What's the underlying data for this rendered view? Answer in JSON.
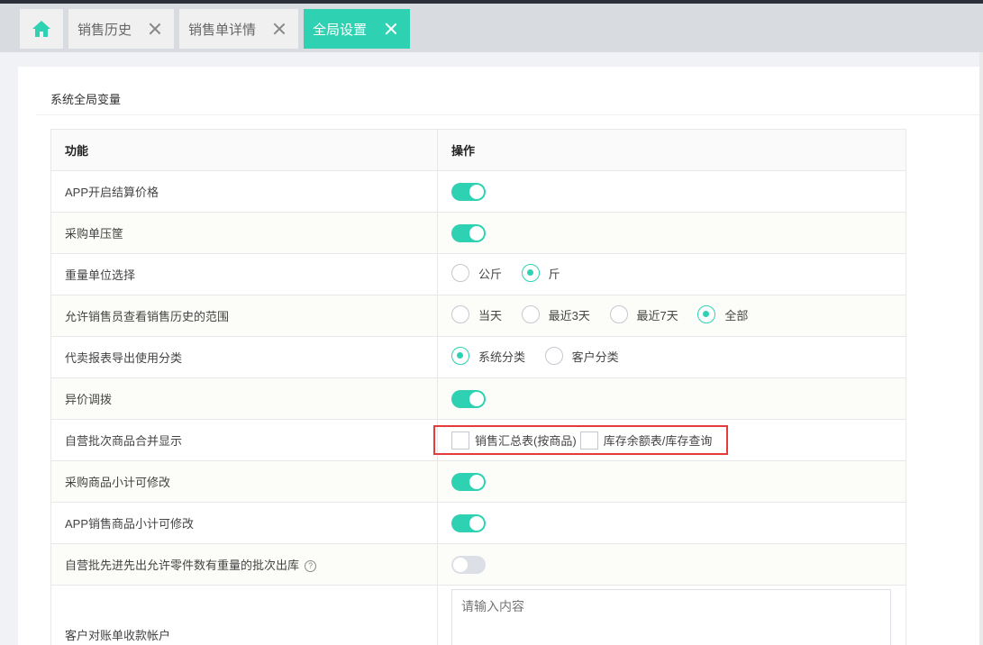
{
  "tabs": [
    {
      "label": "销售历史"
    },
    {
      "label": "销售单详情"
    },
    {
      "label": "全局设置",
      "active": true
    }
  ],
  "section_title": "系统全局变量",
  "table": {
    "headers": {
      "feature": "功能",
      "action": "操作"
    },
    "rows": [
      {
        "label": "APP开启结算价格",
        "switch": true
      },
      {
        "label": "采购单压筐",
        "switch": true
      },
      {
        "label": "重量单位选择",
        "options": [
          "公斤",
          "斤"
        ],
        "selected": 1
      },
      {
        "label": "允许销售员查看销售历史的范围",
        "options": [
          "当天",
          "最近3天",
          "最近7天",
          "全部"
        ],
        "selected": 3
      },
      {
        "label": "代卖报表导出使用分类",
        "options": [
          "系统分类",
          "客户分类"
        ],
        "selected": 0
      },
      {
        "label": "异价调拨",
        "switch": true
      },
      {
        "label": "自营批次商品合并显示",
        "checkboxes": [
          "销售汇总表(按商品)",
          "库存余额表/库存查询"
        ]
      },
      {
        "label": "采购商品小计可修改",
        "switch": true
      },
      {
        "label": "APP销售商品小计可修改",
        "switch": true
      },
      {
        "label": "自营批先进先出允许零件数有重量的批次出库",
        "help": "?",
        "switch": false
      },
      {
        "label": "客户对账单收款帐户",
        "placeholder": "请输入内容"
      }
    ]
  },
  "colors": {
    "accent": "#2ed2b2",
    "highlight": "#e53b3b"
  }
}
